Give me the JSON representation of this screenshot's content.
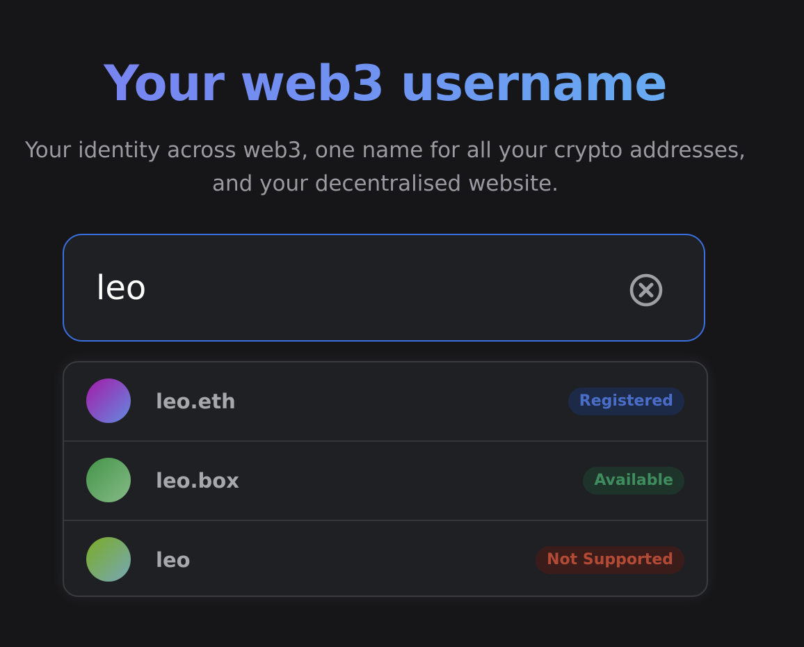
{
  "header": {
    "title": "Your web3 username",
    "subtitle_line1": "Your identity across web3, one name for all your crypto addresses,",
    "subtitle_line2": "and your decentralised website."
  },
  "search": {
    "value": "leo",
    "clear_icon": "close-circle-icon",
    "border_color": "#3b6fe0"
  },
  "results": [
    {
      "name": "leo.eth",
      "status": "Registered",
      "avatar_gradient": [
        "#9b2bb0",
        "#6d7ad8"
      ],
      "badge_bg": "#1c2a48",
      "badge_color": "#4a6ec8"
    },
    {
      "name": "leo.box",
      "status": "Available",
      "avatar_gradient": [
        "#4e9a52",
        "#7cb57e"
      ],
      "badge_bg": "#1e3329",
      "badge_color": "#3f8c5e"
    },
    {
      "name": "leo",
      "status": "Not Supported",
      "avatar_gradient": [
        "#7aab3a",
        "#78a8a0"
      ],
      "badge_bg": "#3a1d1a",
      "badge_color": "#b34a35"
    }
  ]
}
